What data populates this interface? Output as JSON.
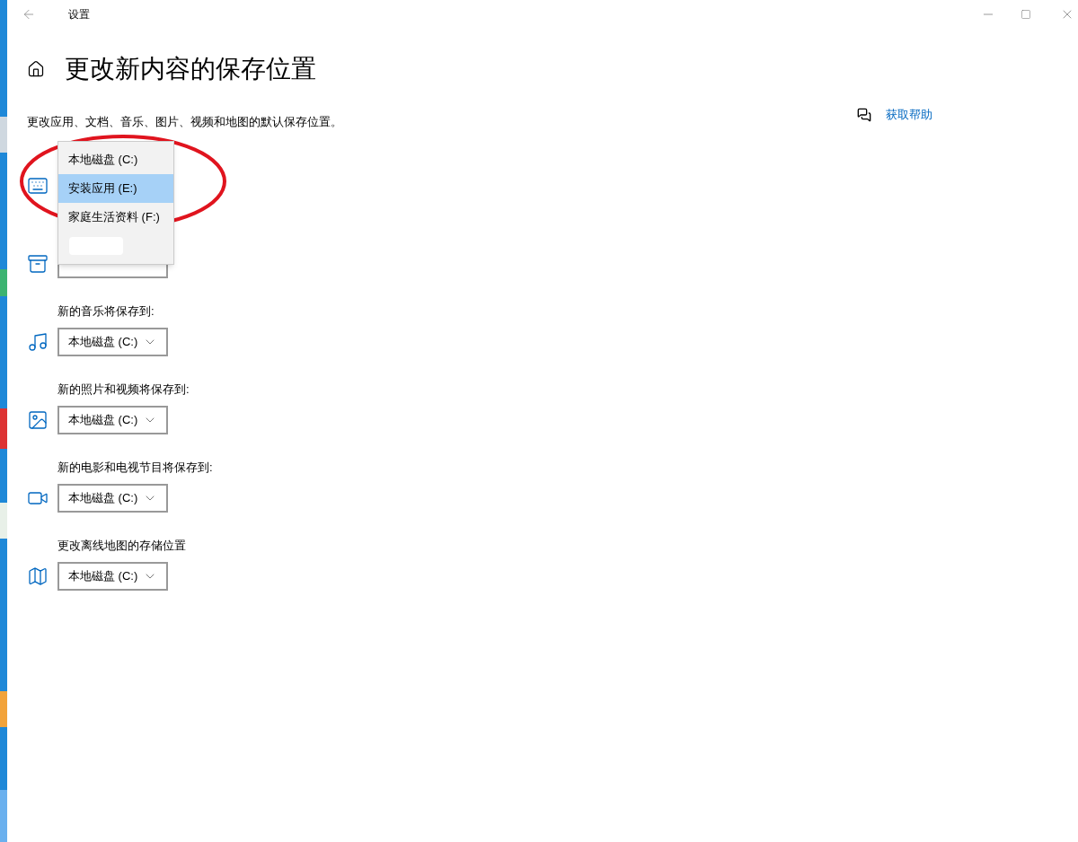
{
  "window": {
    "title": "设置"
  },
  "page": {
    "heading": "更改新内容的保存位置",
    "description": "更改应用、文档、音乐、图片、视频和地图的默认保存位置。",
    "help_link": "获取帮助"
  },
  "sections": [
    {
      "kind": "apps"
    },
    {
      "kind": "documents",
      "covered": true
    },
    {
      "kind": "music",
      "label": "新的音乐将保存到:",
      "value": "本地磁盘 (C:)"
    },
    {
      "kind": "photos",
      "label": "新的照片和视频将保存到:",
      "value": "本地磁盘 (C:)"
    },
    {
      "kind": "movies",
      "label": "新的电影和电视节目将保存到:",
      "value": "本地磁盘 (C:)"
    },
    {
      "kind": "maps",
      "label": "更改离线地图的存储位置",
      "value": "本地磁盘 (C:)"
    }
  ],
  "dropdown": {
    "items": [
      {
        "label": "本地磁盘 (C:)",
        "selected": false
      },
      {
        "label": "安装应用 (E:)",
        "selected": true
      },
      {
        "label": "家庭生活资料 (F:)",
        "selected": false
      },
      {
        "kind": "redacted"
      }
    ]
  }
}
